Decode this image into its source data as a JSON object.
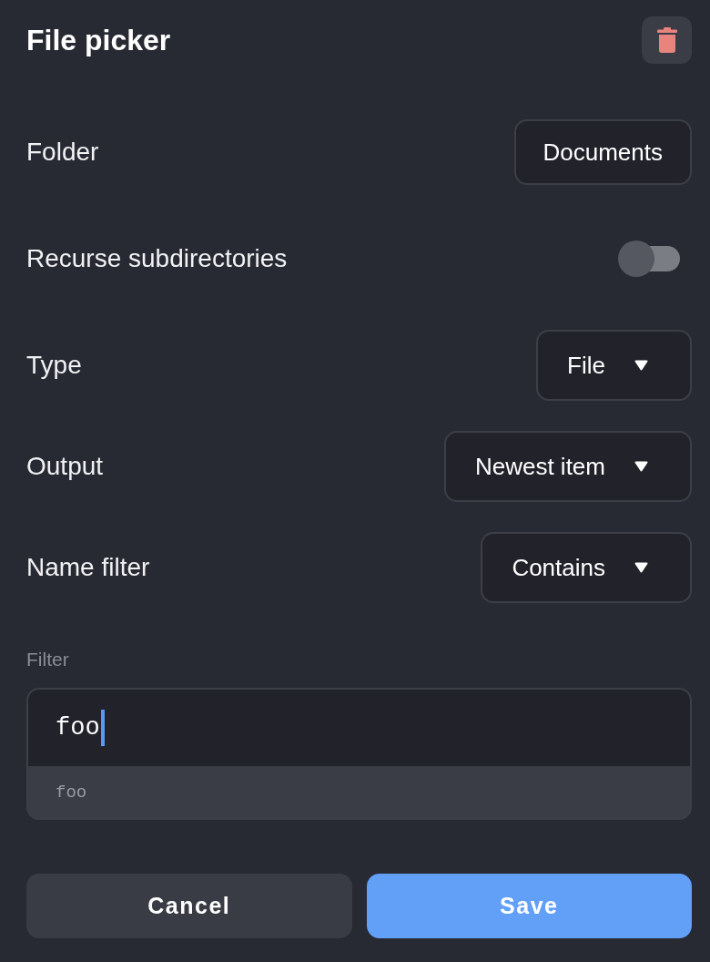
{
  "title": "File picker",
  "fields": [
    {
      "kind": "button",
      "label": "Folder",
      "value": "Documents"
    },
    {
      "kind": "toggle",
      "label": "Recurse subdirectories",
      "on": false
    },
    {
      "kind": "dropdown",
      "label": "Type",
      "value": "File"
    },
    {
      "kind": "dropdown",
      "label": "Output",
      "value": "Newest item"
    },
    {
      "kind": "dropdown",
      "label": "Name filter",
      "value": "Contains"
    }
  ],
  "filter": {
    "label": "Filter",
    "value": "foo",
    "focused": true,
    "suggestions": [
      "foo"
    ]
  },
  "buttons": [
    {
      "label": "Cancel",
      "kind": "secondary"
    },
    {
      "label": "Save",
      "kind": "primary"
    }
  ]
}
